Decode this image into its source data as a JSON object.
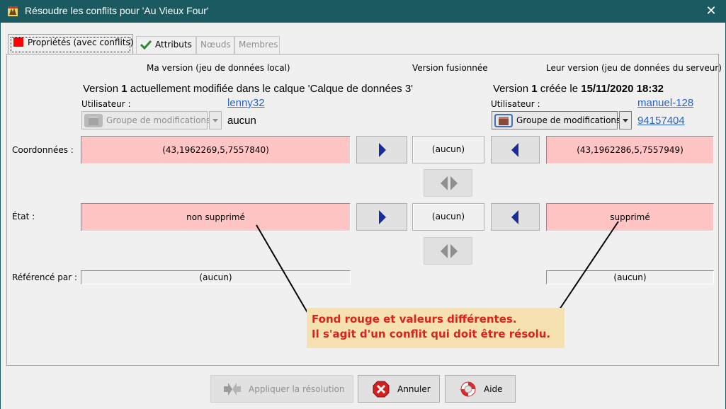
{
  "window": {
    "title": "Résoudre les conflits pour 'Au Vieux Four'",
    "close_glyph": "✕"
  },
  "tabs": [
    {
      "label": "Propriétés (avec conflits)",
      "active": true,
      "enabled": true
    },
    {
      "label": "Attributs",
      "active": false,
      "enabled": true
    },
    {
      "label": "Nœuds",
      "active": false,
      "enabled": false
    },
    {
      "label": "Membres",
      "active": false,
      "enabled": false
    }
  ],
  "headers": {
    "mine": "Ma version (jeu de données local)",
    "merged": "Version fusionnée",
    "theirs": "Leur version (jeu de données du serveur)"
  },
  "mine": {
    "version_prefix": "Version ",
    "version_num": "1",
    "version_desc": " actuellement modifiée dans le calque 'Calque de données 3'",
    "user_label": "Utilisateur :",
    "user": "lenny32",
    "changeset_combo": "Groupe de modifications",
    "changeset": "aucun",
    "coordinates": "(43,1962269,5,7557840)",
    "state": "non supprimé",
    "referenced_by": "(aucun)"
  },
  "theirs": {
    "version_prefix": "Version ",
    "version_num": "1",
    "version_desc": " créée le ",
    "version_date": "15/11/2020 18:32",
    "user_label": "Utilisateur :",
    "user": "manuel-128",
    "changeset_combo": "Groupe de modifications",
    "changeset": "94157404",
    "coordinates": "(43,1962286,5,7557949)",
    "state": "supprimé",
    "referenced_by": "(aucun)"
  },
  "merged": {
    "coordinates": "(aucun)",
    "state": "(aucun)"
  },
  "row_labels": {
    "coordinates": "Coordonnées :",
    "state": "État :",
    "referenced_by": "Référencé par :"
  },
  "callout": {
    "line1": "Fond rouge et valeurs différentes.",
    "line2": "Il s'agit d'un conflit qui doit être résolu."
  },
  "footer": {
    "apply": "Appliquer la résolution",
    "cancel": "Annuler",
    "help": "Aide"
  },
  "colors": {
    "titlebar": "#1b5a61",
    "conflict_bg": "#ffc4c4",
    "callout_bg": "#f5e2b0",
    "callout_text": "#e0201c",
    "link": "#2a62c9",
    "arrow": "#1a2c9c"
  }
}
